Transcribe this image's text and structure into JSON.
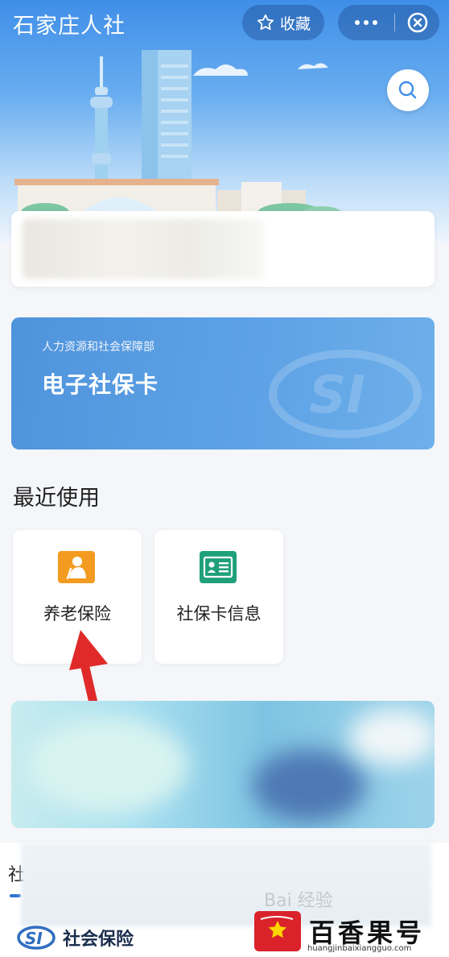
{
  "header": {
    "title": "石家庄人社",
    "favorite_label": "收藏",
    "more_icon": "more-dots-icon",
    "close_icon": "close-circle-icon",
    "search_icon": "search-icon"
  },
  "ss_card": {
    "subtitle": "人力资源和社会保障部",
    "title": "电子社保卡",
    "logo_text": "SI"
  },
  "recent": {
    "title": "最近使用",
    "items": [
      {
        "label": "养老保险",
        "icon": "pension-icon",
        "color": "#f39b20"
      },
      {
        "label": "社保卡信息",
        "icon": "id-card-icon",
        "color": "#1fa07a"
      }
    ]
  },
  "bottom": {
    "tab_label": "社",
    "footer_label": "社会保险",
    "footer_logo": "SI"
  },
  "watermark": {
    "brand": "百香果号",
    "url": "huangjinbaixiangguo.com",
    "baidu": "Bai 经验"
  },
  "colors": {
    "accent": "#3f8ee8",
    "card_blue": "#5a9ee2",
    "arrow_red": "#e02a2a"
  }
}
